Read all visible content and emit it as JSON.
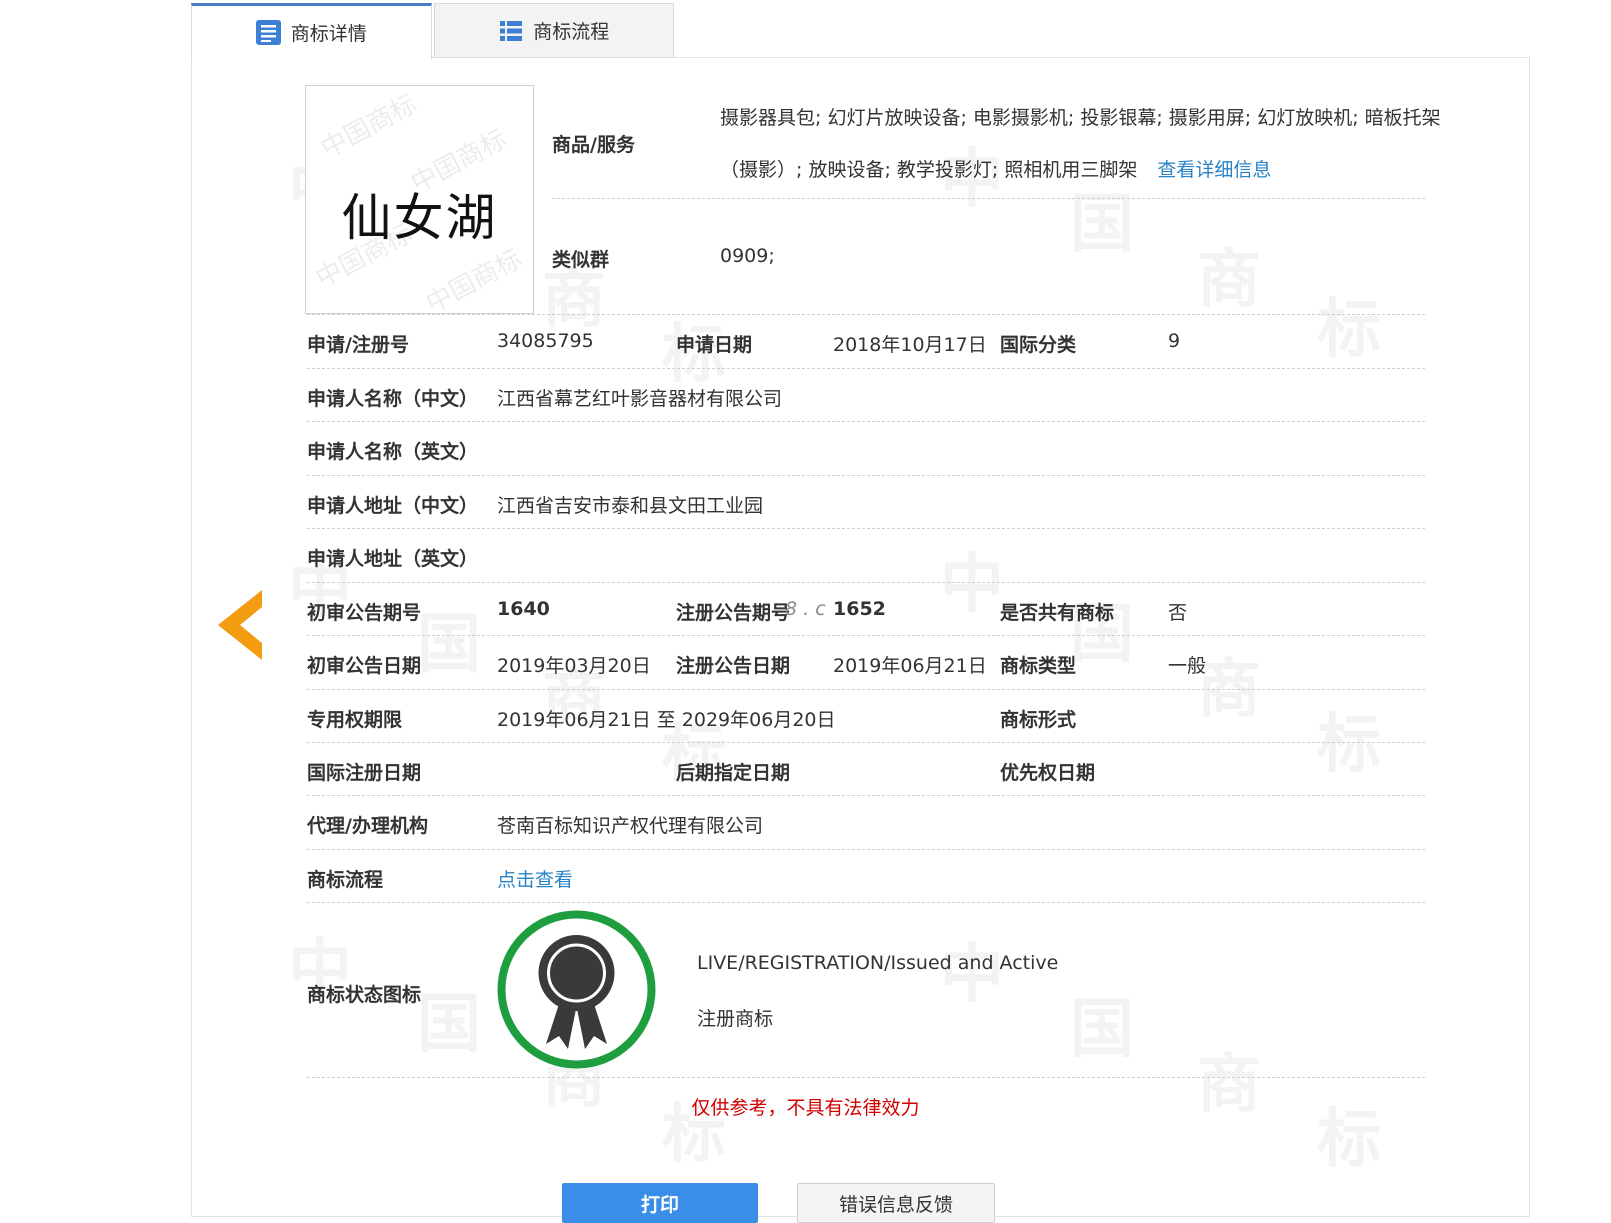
{
  "tabs": [
    {
      "label": "商标详情",
      "icon": "document-list-icon",
      "active": true
    },
    {
      "label": "商标流程",
      "icon": "list-icon",
      "active": false
    }
  ],
  "trademark": {
    "image_text": "仙女湖",
    "watermark_text": "中国商标"
  },
  "goods": {
    "label": "商品/服务",
    "line1": "摄影器具包; 幻灯片放映设备; 电影摄影机; 投影银幕; 摄影用屏; 幻灯放映机; 暗板托架",
    "line2": "（摄影）; 放映设备; 教学投影灯; 照相机用三脚架",
    "detail_link": "查看详细信息"
  },
  "similar_group": {
    "label": "类似群",
    "value": "0909;"
  },
  "fields": {
    "reg_no": {
      "label": "申请/注册号",
      "value": "34085795"
    },
    "app_date": {
      "label": "申请日期",
      "value": "2018年10月17日"
    },
    "intl_class": {
      "label": "国际分类",
      "value": "9"
    },
    "applicant_cn": {
      "label": "申请人名称（中文）",
      "value": "江西省幕艺红叶影音器材有限公司"
    },
    "applicant_en": {
      "label": "申请人名称（英文）",
      "value": ""
    },
    "address_cn": {
      "label": "申请人地址（中文）",
      "value": "江西省吉安市泰和县文田工业园"
    },
    "address_en": {
      "label": "申请人地址（英文）",
      "value": ""
    },
    "prelim_issue": {
      "label": "初审公告期号",
      "value": "1640"
    },
    "reg_issue": {
      "label": "注册公告期号",
      "value": "1652"
    },
    "shared": {
      "label": "是否共有商标",
      "value": "否"
    },
    "prelim_date": {
      "label": "初审公告日期",
      "value": "2019年03月20日"
    },
    "reg_date": {
      "label": "注册公告日期",
      "value": "2019年06月21日"
    },
    "tm_type": {
      "label": "商标类型",
      "value": "一般"
    },
    "exclusive_period": {
      "label": "专用权期限",
      "value": "2019年06月21日 至 2029年06月20日"
    },
    "tm_form": {
      "label": "商标形式",
      "value": ""
    },
    "intl_reg_date": {
      "label": "国际注册日期",
      "value": ""
    },
    "later_designation_date": {
      "label": "后期指定日期",
      "value": ""
    },
    "priority_date": {
      "label": "优先权日期",
      "value": ""
    },
    "agent": {
      "label": "代理/办理机构",
      "value": "苍南百标知识产权代理有限公司"
    },
    "flow": {
      "label": "商标流程",
      "link": "点击查看"
    },
    "status": {
      "label": "商标状态图标",
      "text_en": "LIVE/REGISTRATION/Issued and Active",
      "text_cn": "注册商标"
    }
  },
  "overlay_text": "8 . c",
  "disclaimer": "仅供参考，不具有法律效力",
  "buttons": {
    "print": "打印",
    "feedback": "错误信息反馈"
  },
  "colors": {
    "accent": "#3b8ee8",
    "link": "#2a82c6",
    "warning": "#d10000",
    "back_arrow": "#f39c12",
    "status_ring": "#1e9e3e"
  }
}
